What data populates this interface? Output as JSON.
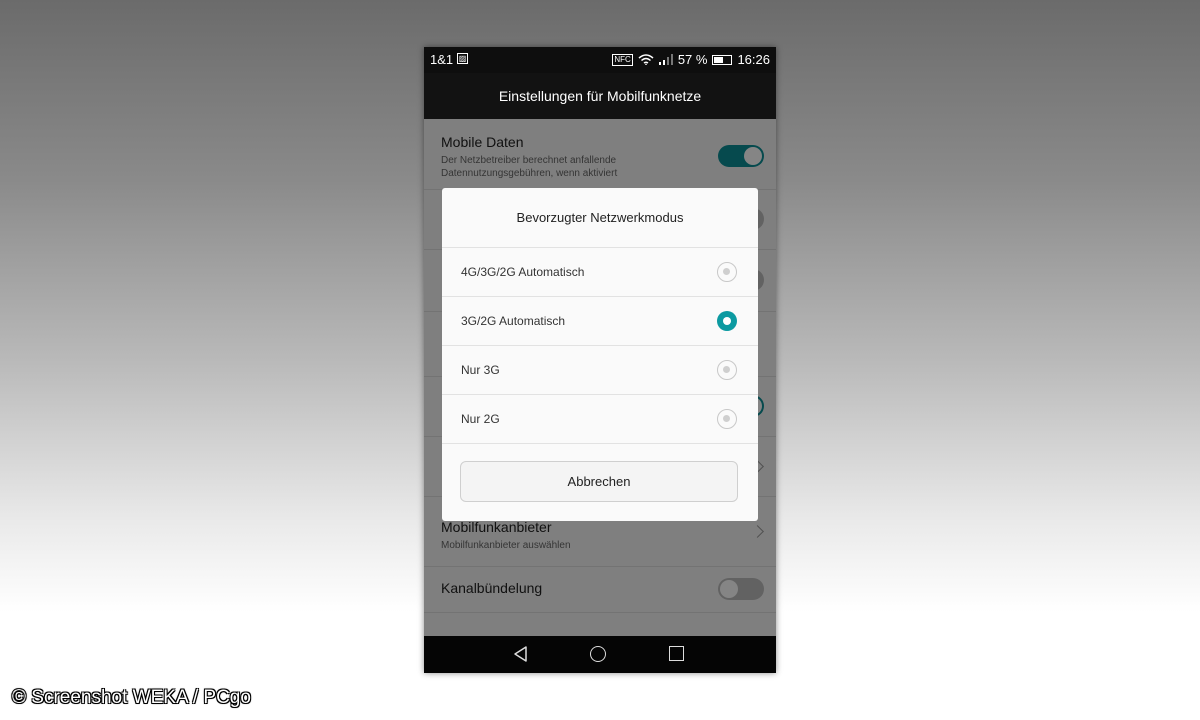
{
  "status_bar": {
    "carrier": "1&1",
    "nfc": "NFC",
    "battery_level": "57 %",
    "battery_fraction": 0.57,
    "time": "16:26"
  },
  "app": {
    "title": "Einstellungen für Mobilfunknetze"
  },
  "settings": {
    "mobile_data": {
      "title": "Mobile Daten",
      "description": "Der Netzbetreiber berechnet anfallende Datennutzungsgebühren, wenn aktiviert",
      "enabled": true
    },
    "carrier": {
      "title": "Mobilfunkanbieter",
      "description": "Mobilfunkanbieter auswählen"
    },
    "carrier_aggregation": {
      "title": "Kanalbündelung",
      "enabled": false
    }
  },
  "dialog": {
    "title": "Bevorzugter Netzwerkmodus",
    "options": [
      {
        "label": "4G/3G/2G Automatisch",
        "selected": false
      },
      {
        "label": "3G/2G Automatisch",
        "selected": true
      },
      {
        "label": "Nur 3G",
        "selected": false
      },
      {
        "label": "Nur 2G",
        "selected": false
      }
    ],
    "cancel_label": "Abbrechen"
  },
  "watermark": "© Screenshot WEKA / PCgo",
  "colors": {
    "accent": "#0c9aa1",
    "toolbar": "#121212"
  }
}
